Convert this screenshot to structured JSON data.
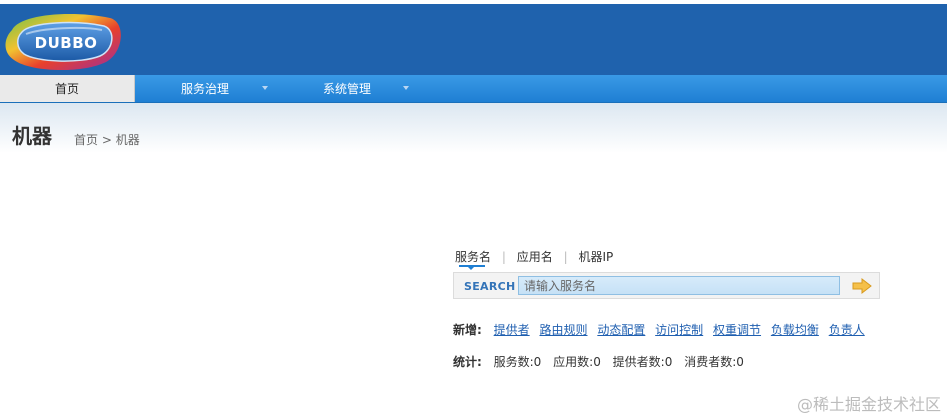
{
  "logo": {
    "text": "DUBBO"
  },
  "nav": {
    "home": "首页",
    "services": "服务治理",
    "system": "系统管理"
  },
  "page": {
    "title": "机器",
    "breadcrumb": {
      "home": "首页",
      "separator": ">",
      "current": "机器"
    }
  },
  "search": {
    "tabs": [
      "服务名",
      "应用名",
      "机器IP"
    ],
    "active_tab": "服务名",
    "label": "SEARCH",
    "placeholder": "请输入服务名",
    "value": ""
  },
  "new_row": {
    "label": "新增:",
    "links": [
      "提供者",
      "路由规则",
      "动态配置",
      "访问控制",
      "权重调节",
      "负载均衡",
      "负责人"
    ]
  },
  "stats_row": {
    "label": "统计:",
    "items": [
      "服务数:0",
      "应用数:0",
      "提供者数:0",
      "消费者数:0"
    ]
  },
  "watermark": "@稀土掘金技术社区",
  "colors": {
    "header_bg": "#1f62ad",
    "nav_bg": "#2a8ae0",
    "link": "#1f5fb0",
    "search_label": "#3474b8",
    "go_arrow": "#f5c04a"
  }
}
